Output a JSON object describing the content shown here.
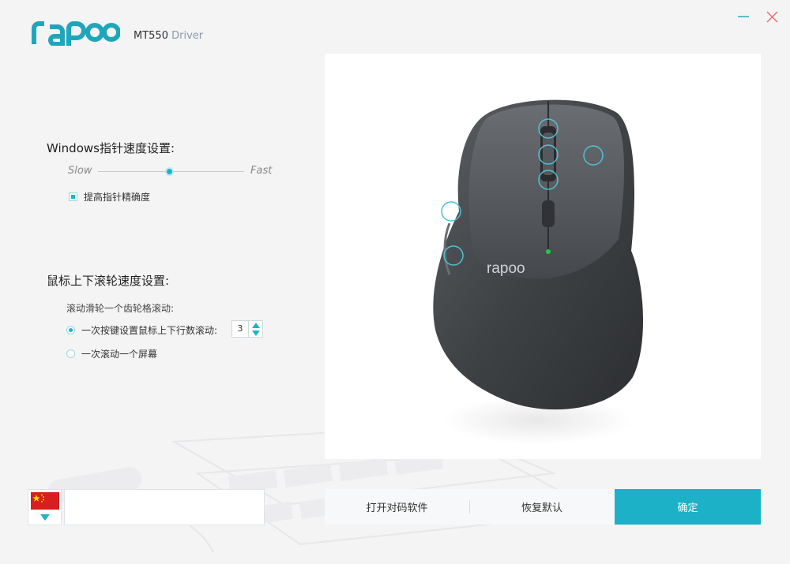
{
  "header": {
    "brand": "rapoo",
    "model": "MT550",
    "driver_word": "Driver"
  },
  "pointer": {
    "title": "Windows指针速度设置:",
    "slow_label": "Slow",
    "fast_label": "Fast",
    "speed_fraction": 0.49,
    "precision_label": "提高指针精确度",
    "precision_checked": true
  },
  "scroll": {
    "title": "鼠标上下滚轮速度设置:",
    "sub_label": "滚动滑轮一个齿轮格滚动:",
    "option_lines_label": "一次按键设置鼠标上下行数滚动:",
    "option_lines_checked": true,
    "lines_value": "3",
    "option_screen_label": "一次滚动一个屏幕",
    "option_screen_checked": false
  },
  "mouse_image": {
    "logo_text": "rapoo"
  },
  "footer": {
    "open_pairing_label": "打开对码软件",
    "restore_default_label": "恢复默认",
    "confirm_label": "确定"
  },
  "colors": {
    "accent": "#1cb1c6",
    "brand": "#1fa6bb",
    "flag_red": "#d81e1e",
    "flag_yellow": "#ffde00"
  },
  "icons": {
    "minimize": "minimize-icon",
    "close": "close-icon",
    "language_dropdown": "chevron-down-icon",
    "stepper_up": "triangle-up-icon",
    "stepper_down": "triangle-down-icon"
  }
}
